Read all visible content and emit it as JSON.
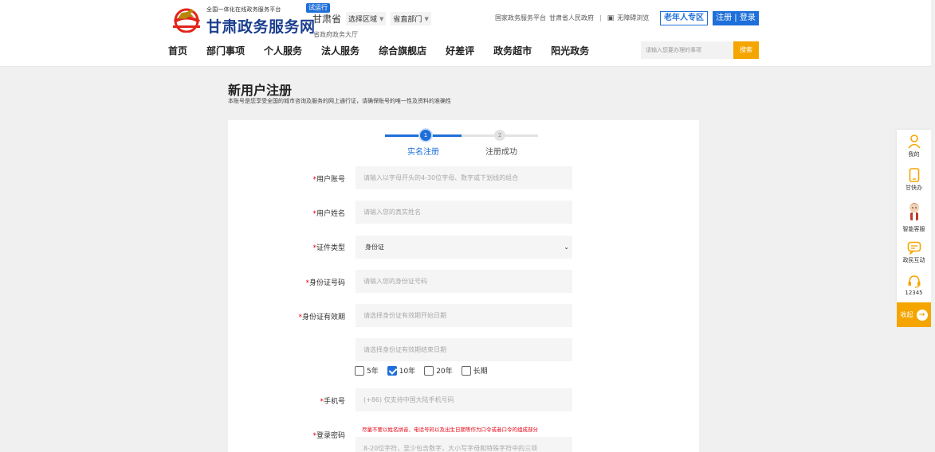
{
  "header": {
    "slogan": "全国一体化在线政务服务平台",
    "site_name": "甘肃政务服务网",
    "trial_badge": "试运行",
    "province": "甘肃省",
    "region_select": "选择区域",
    "dept_select": "省直部门",
    "hall": "省政府政务大厅",
    "links": [
      "国家政务服务平台",
      "甘肃省人民政府"
    ],
    "accessibility": "无障碍浏览",
    "elder_button": "老年人专区",
    "login_button": "注册 | 登录",
    "nav": [
      "首页",
      "部门事项",
      "个人服务",
      "法人服务",
      "综合旗舰店",
      "好差评",
      "政务超市",
      "阳光政务"
    ],
    "search_placeholder": "请输入您要办理的事项",
    "search_button": "搜索"
  },
  "page": {
    "title": "新用户注册",
    "subtitle": "本账号是您享受全国的城市咨询及服务的网上通行证，请确保账号的唯一性及资料的准确性"
  },
  "steps": [
    {
      "number": "1",
      "label": "实名注册",
      "active": true
    },
    {
      "number": "2",
      "label": "注册成功",
      "active": false
    }
  ],
  "form": {
    "account_label": "用户账号",
    "account_placeholder": "请输入以字母开头的4-30位字母、数字或下划线的组合",
    "name_label": "用户姓名",
    "name_placeholder": "请输入您的真实姓名",
    "id_type_label": "证件类型",
    "id_type_value": "身份证",
    "id_number_label": "身份证号码",
    "id_number_placeholder": "请输入您的身份证号码",
    "validity_label": "身份证有效期",
    "validity_start_placeholder": "请选择身份证有效期开始日期",
    "validity_end_placeholder": "请选择身份证有效期结束日期",
    "validity_options": [
      {
        "label": "5年",
        "checked": false
      },
      {
        "label": "10年",
        "checked": true
      },
      {
        "label": "20年",
        "checked": false
      },
      {
        "label": "长期",
        "checked": false
      }
    ],
    "phone_label": "手机号",
    "phone_placeholder": "(+86) 仅支持中国大陆手机号码",
    "password_label": "登录密码",
    "password_hint": "尽量不要以姓名拼音、电话号码以及出生日期等作为口令或者口令的组成部分",
    "password_placeholder": "8-20位字符，至少包含数字，大小写字母和特殊字符中的三项"
  },
  "sidebar": {
    "items": [
      "我的",
      "甘快办",
      "智能客服",
      "政民互动",
      "12345"
    ],
    "collapse": "收起"
  },
  "colors": {
    "brand_blue": "#1e6fd9",
    "accent_orange": "#f5a500",
    "required_red": "#e60012"
  }
}
